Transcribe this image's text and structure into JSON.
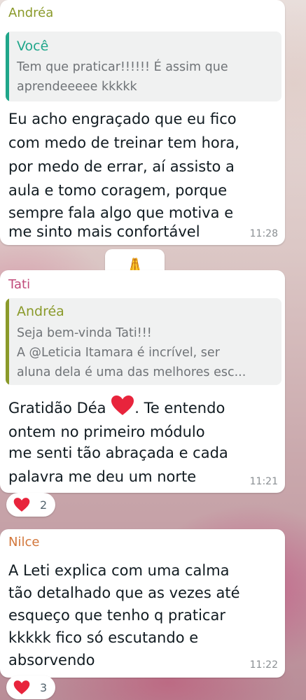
{
  "messages": [
    {
      "sender": "Andréa",
      "quote": {
        "sender": "Você",
        "lines": [
          "Tem que praticar!!!!!! É assim que",
          "aprendeeeee kkkkk"
        ]
      },
      "lines": [
        "Eu acho engraçado que eu fico",
        "com medo de treinar tem hora,",
        "por medo de errar, aí assisto a",
        "aula e tomo coragem, porque",
        "sempre fala algo que motiva e",
        "me sinto mais confortável"
      ],
      "time": "11:28"
    },
    {
      "sender": "Tati",
      "quote": {
        "sender": "Andréa",
        "lines": [
          "Seja bem-vinda Tati!!!",
          "A @Leticia Itamara é incrível, ser",
          "aluna dela é uma das melhores esc..."
        ]
      },
      "lines": [
        "Gratidão Déa",
        ". Te entendo",
        "ontem no primeiro módulo",
        "me senti tão abraçada e cada",
        "palavra me deu um norte"
      ],
      "time": "11:21",
      "reaction": {
        "emoji": "heart-icon",
        "count": "2"
      }
    },
    {
      "sender": "Nilce",
      "lines": [
        "A Leti explica com uma calma",
        "tão detalhado que as vezes até",
        "esqueço que tenho q praticar",
        "kkkkk fico só escutando e",
        "absorvendo"
      ],
      "time": "11:22",
      "reaction": {
        "emoji": "heart-icon",
        "count": "3"
      }
    }
  ],
  "sticker": {
    "emoji": "🙏",
    "icon": "praying-hands-icon"
  },
  "colors": {
    "andrea": "#8a9a2a",
    "voce": "#1fa68a",
    "tati": "#c04a7a",
    "nilce": "#d2763a",
    "heart": "#e8243c"
  }
}
